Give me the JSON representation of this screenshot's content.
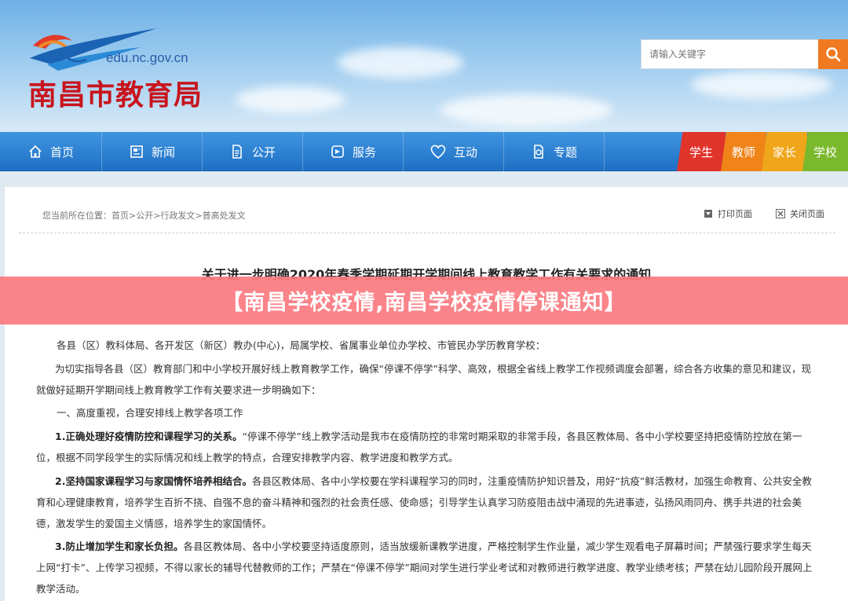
{
  "header": {
    "domain": "edu.nc.gov.cn",
    "title": "南昌市教育局"
  },
  "search": {
    "placeholder": "请输入关键字"
  },
  "nav": {
    "items": [
      {
        "label": "首页",
        "icon": "home-icon"
      },
      {
        "label": "新闻",
        "icon": "news-icon"
      },
      {
        "label": "公开",
        "icon": "document-icon"
      },
      {
        "label": "服务",
        "icon": "service-icon"
      },
      {
        "label": "互动",
        "icon": "heart-icon"
      },
      {
        "label": "专题",
        "icon": "topic-icon"
      }
    ],
    "roles": [
      {
        "label": "学生",
        "color": "#e0342b"
      },
      {
        "label": "教师",
        "color": "#f08419"
      },
      {
        "label": "家长",
        "color": "#efa61a"
      },
      {
        "label": "学校",
        "color": "#7ab82c"
      }
    ]
  },
  "breadcrumb": {
    "prefix": "您当前所在位置：",
    "path": "首页>公开>行政发文>普高处发文"
  },
  "tools": {
    "print": "打印页面",
    "close": "关闭页面"
  },
  "doc": {
    "title": "关于进一步明确2020年春季学期延期开学期间线上教育教学工作有关要求的通知",
    "salutation": "各县（区）教科体局、各开发区（新区）教办(中心)，局属学校、省属事业单位办学校、市管民办学历教育学校：",
    "intro": "为切实指导各县（区）教育部门和中小学校开展好线上教育教学工作，确保“停课不停学”科学、高效，根据全省线上教学工作视频调度会部署，综合各方收集的意见和建议，现就做好延期开学期间线上教育教学工作有关要求进一步明确如下：",
    "section1": "一、高度重视，合理安排线上教学各项工作",
    "item1_head": "1.正确处理好疫情防控和课程学习的关系。",
    "item1_body": "“停课不停学”线上教学活动是我市在疫情防控的非常时期采取的非常手段，各县区教体局、各中小学校要坚持把疫情防控放在第一位，根据不同学段学生的实际情况和线上教学的特点，合理安排教学内容、教学进度和教学方式。",
    "item2_head": "2.坚持国家课程学习与家国情怀培养相结合。",
    "item2_body": "各县区教体局、各中小学校要在学科课程学习的同时，注重疫情防护知识普及，用好“抗疫”鲜活教材，加强生命教育、公共安全教育和心理健康教育，培养学生百折不挠、自强不息的奋斗精神和强烈的社会责任感、使命感；引导学生认真学习防疫阻击战中涌现的先进事迹，弘扬风雨同舟、携手共进的社会美德，激发学生的爱国主义情感，培养学生的家国情怀。",
    "item3_head": "3.防止增加学生和家长负担。",
    "item3_body": "各县区教体局、各中小学校要坚持适度原则，适当放缓新课教学进度，严格控制学生作业量，减少学生观看电子屏幕时间；严禁强行要求学生每天上网“打卡”、上传学习视频，不得以家长的辅导代替教师的工作；严禁在“停课不停学”期间对学生进行学业考试和对教师进行教学进度、教学业绩考核；严禁在幼儿园阶段开展网上教学活动。"
  },
  "banner": {
    "text": "【南昌学校疫情,南昌学校疫情停课通知】"
  }
}
